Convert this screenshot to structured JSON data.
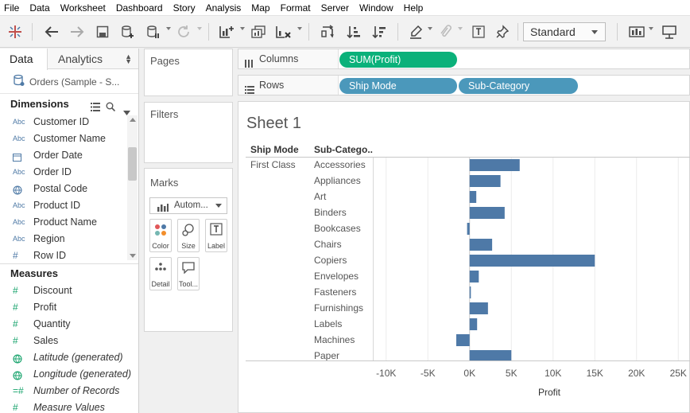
{
  "menu": [
    "File",
    "Data",
    "Worksheet",
    "Dashboard",
    "Story",
    "Analysis",
    "Map",
    "Format",
    "Server",
    "Window",
    "Help"
  ],
  "toolbar": {
    "fit_mode": "Standard"
  },
  "left_pane": {
    "tabs": {
      "data": "Data",
      "analytics": "Analytics"
    },
    "datasource": "Orders (Sample - S...",
    "dimensions_label": "Dimensions",
    "dimensions": [
      {
        "type": "Abc",
        "label": "Customer ID"
      },
      {
        "type": "Abc",
        "label": "Customer Name"
      },
      {
        "type": "date",
        "label": "Order Date"
      },
      {
        "type": "Abc",
        "label": "Order ID"
      },
      {
        "type": "geo",
        "label": "Postal Code"
      },
      {
        "type": "Abc",
        "label": "Product ID"
      },
      {
        "type": "Abc",
        "label": "Product Name"
      },
      {
        "type": "Abc",
        "label": "Region"
      },
      {
        "type": "#",
        "label": "Row ID"
      }
    ],
    "measures_label": "Measures",
    "measures": [
      {
        "type": "#",
        "label": "Discount"
      },
      {
        "type": "#",
        "label": "Profit"
      },
      {
        "type": "#",
        "label": "Quantity"
      },
      {
        "type": "#",
        "label": "Sales"
      },
      {
        "type": "geo",
        "label": "Latitude (generated)"
      },
      {
        "type": "geo",
        "label": "Longitude (generated)"
      },
      {
        "type": "#=",
        "label": "Number of Records"
      },
      {
        "type": "#",
        "label": "Measure Values"
      }
    ]
  },
  "cards": {
    "pages": "Pages",
    "filters": "Filters",
    "marks": "Marks",
    "mark_type": "Autom...",
    "buttons": {
      "color": "Color",
      "size": "Size",
      "label": "Label",
      "detail": "Detail",
      "tooltip": "Tool..."
    }
  },
  "shelves": {
    "columns_label": "Columns",
    "columns_pills": [
      "SUM(Profit)"
    ],
    "rows_label": "Rows",
    "rows_pills": [
      "Ship Mode",
      "Sub-Category"
    ]
  },
  "sheet": {
    "title": "Sheet 1",
    "header_ship_mode": "Ship Mode",
    "header_subcategory": "Sub-Catego..",
    "ship_mode": "First Class",
    "x_axis_title": "Profit"
  },
  "chart_data": {
    "type": "bar",
    "orientation": "horizontal",
    "categories": [
      "Accessories",
      "Appliances",
      "Art",
      "Binders",
      "Bookcases",
      "Chairs",
      "Copiers",
      "Envelopes",
      "Fasteners",
      "Furnishings",
      "Labels",
      "Machines",
      "Paper"
    ],
    "values": [
      6000,
      3700,
      800,
      4200,
      -300,
      2700,
      15000,
      1100,
      150,
      2200,
      900,
      -1600,
      5000
    ],
    "xlabel": "Profit",
    "xlim": [
      -11500,
      26500
    ],
    "x_ticks": [
      -10000,
      -5000,
      0,
      5000,
      10000,
      15000,
      20000,
      25000
    ],
    "x_tick_labels": [
      "-10K",
      "-5K",
      "0K",
      "5K",
      "10K",
      "15K",
      "20K",
      "25K"
    ],
    "grid": "vertical",
    "bar_color": "#4e79a7"
  }
}
